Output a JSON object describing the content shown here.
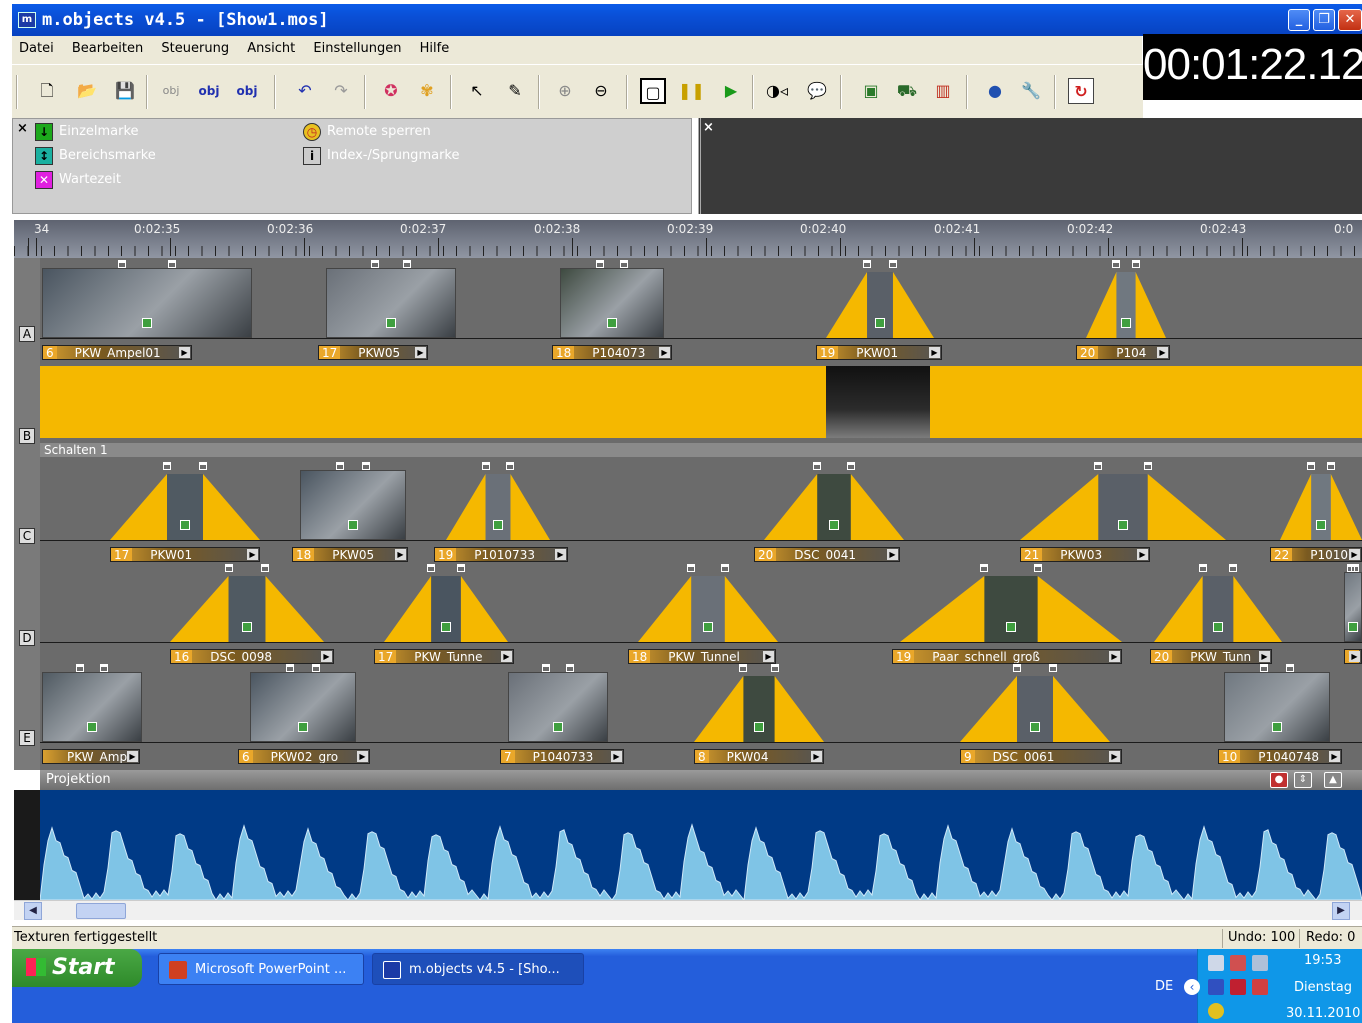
{
  "window": {
    "title": "m.objects v4.5 - [Show1.mos]",
    "app_icon": "m"
  },
  "menu": [
    "Datei",
    "Bearbeiten",
    "Steuerung",
    "Ansicht",
    "Einstellungen",
    "Hilfe"
  ],
  "timecode": "00:01:22.12",
  "toolbar": {
    "obj_labels": [
      "obj",
      "obj",
      "obj"
    ],
    "icons": [
      "new-file-icon",
      "open-folder-icon",
      "save-icon",
      "add-object-icon",
      "object-properties-icon",
      "object-icon",
      "undo-icon",
      "redo-icon",
      "refresh-icon",
      "effects-icon",
      "pointer-icon",
      "pen-icon",
      "zoom-in-icon",
      "zoom-out-icon",
      "select-mode-icon",
      "pause-icon",
      "play-icon",
      "audio-icon",
      "speech-icon",
      "image-icon",
      "presentation-icon",
      "columns-icon",
      "drop-icon",
      "wrench-icon",
      "loop-icon"
    ]
  },
  "markers": {
    "left": [
      {
        "label": "Einzelmarke",
        "icon": "arrow-down-icon",
        "color": "#1ca81c"
      },
      {
        "label": "Bereichsmarke",
        "icon": "range-icon",
        "color": "#1ab0a0"
      },
      {
        "label": "Wartezeit",
        "icon": "wait-icon",
        "color": "#e020e0"
      }
    ],
    "right": [
      {
        "label": "Remote sperren",
        "icon": "clock-icon",
        "color": "#e8c020"
      },
      {
        "label": "Index-/Sprungmarke",
        "icon": "index-icon",
        "color": "#cccccc"
      }
    ]
  },
  "ruler": {
    "labels": [
      "34",
      "0:02:35",
      "0:02:36",
      "0:02:37",
      "0:02:38",
      "0:02:39",
      "0:02:40",
      "0:02:41",
      "0:02:42",
      "0:02:43",
      "0:0"
    ]
  },
  "tracks": {
    "letters": [
      "A",
      "B",
      "C",
      "D",
      "E"
    ],
    "schalten_label": "Schalten 1",
    "A": [
      {
        "num": "6",
        "name": "PKW_Ampel01"
      },
      {
        "num": "17",
        "name": "PKW05"
      },
      {
        "num": "18",
        "name": "P104073"
      },
      {
        "num": "19",
        "name": "PKW01"
      },
      {
        "num": "20",
        "name": "P104"
      }
    ],
    "C": [
      {
        "num": "17",
        "name": "PKW01"
      },
      {
        "num": "18",
        "name": "PKW05"
      },
      {
        "num": "19",
        "name": "P1010733"
      },
      {
        "num": "20",
        "name": "DSC_0041"
      },
      {
        "num": "21",
        "name": "PKW03"
      },
      {
        "num": "22",
        "name": "P1010"
      }
    ],
    "D": [
      {
        "num": "16",
        "name": "DSC_0098"
      },
      {
        "num": "17",
        "name": "PKW_Tunne"
      },
      {
        "num": "18",
        "name": "PKW_Tunnel"
      },
      {
        "num": "19",
        "name": "Paar_schnell_groß"
      },
      {
        "num": "20",
        "name": "PKW_Tunn"
      },
      {
        "num": "2",
        "name": ""
      }
    ],
    "E": [
      {
        "num": "",
        "name": "PKW_Ampe"
      },
      {
        "num": "6",
        "name": "PKW02_gro"
      },
      {
        "num": "7",
        "name": "P1040733"
      },
      {
        "num": "8",
        "name": "PKW04"
      },
      {
        "num": "9",
        "name": "DSC_0061"
      },
      {
        "num": "10",
        "name": "P1040748"
      }
    ]
  },
  "projektion_label": "Projektion",
  "status": {
    "message": "Texturen fertiggestellt",
    "undo": "Undo: 100",
    "redo": "Redo: 0"
  },
  "taskbar": {
    "start": "Start",
    "buttons": [
      "Microsoft PowerPoint ...",
      "m.objects v4.5 - [Sho..."
    ],
    "lang": "DE",
    "time": "19:53",
    "day": "Dienstag",
    "date": "30.11.2010"
  },
  "colors": {
    "clip_orange": "#f5b800",
    "audio_bg": "#003a86",
    "audio_wave": "#7fc4e6",
    "titlebar": "#0a4fd6",
    "taskbar": "#245edb",
    "tray": "#0f97e8"
  }
}
